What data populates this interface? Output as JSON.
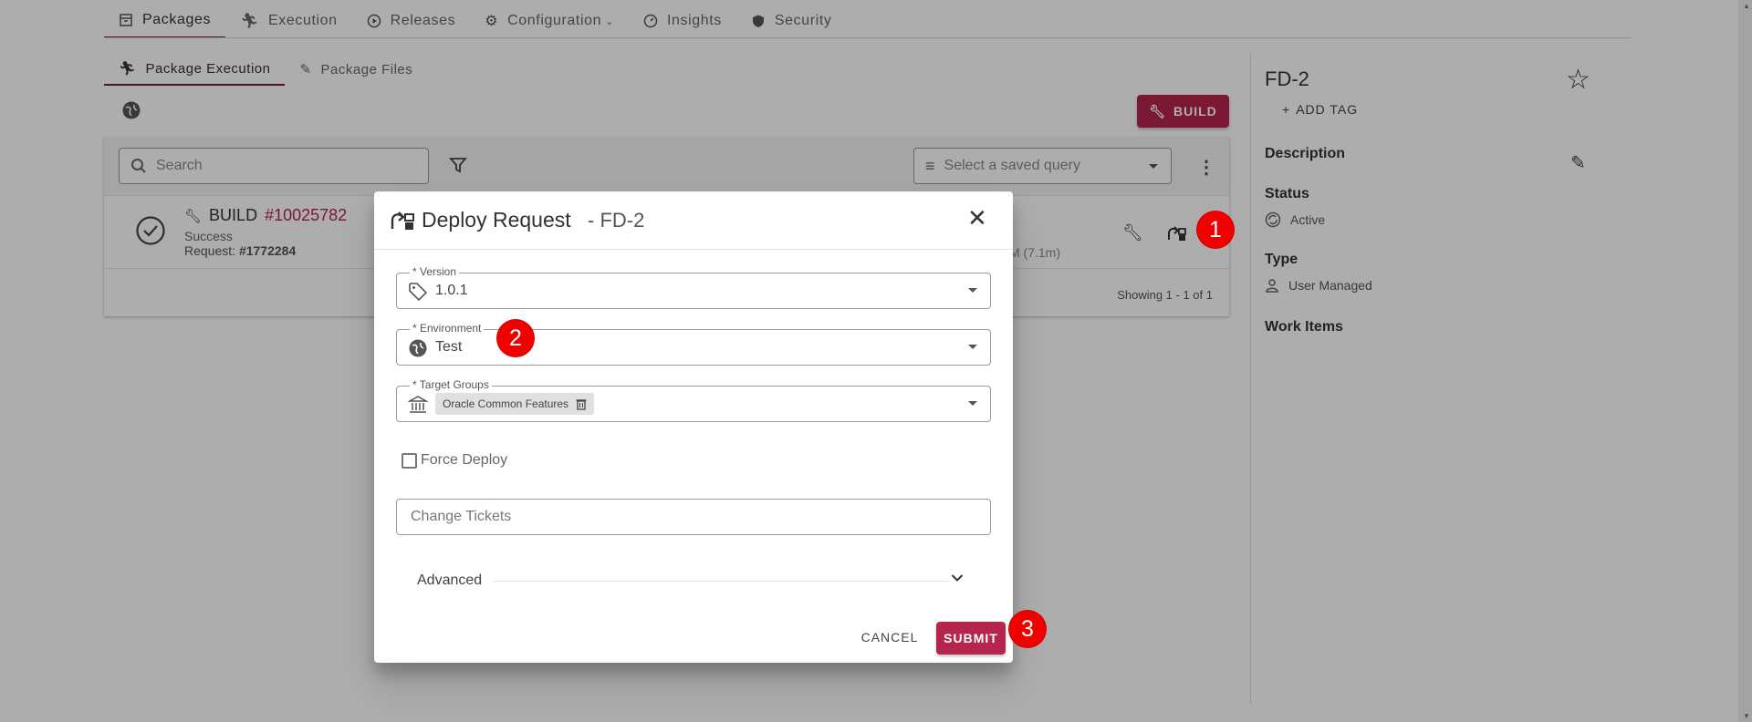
{
  "top_nav": {
    "items": [
      {
        "label": "Packages",
        "icon": "archive-icon",
        "active": true
      },
      {
        "label": "Execution",
        "icon": "walk-icon"
      },
      {
        "label": "Releases",
        "icon": "play-circle-icon"
      },
      {
        "label": "Configuration",
        "icon": "gear-icon"
      },
      {
        "label": "Insights",
        "icon": "gauge-icon"
      },
      {
        "label": "Security",
        "icon": "shield-icon"
      }
    ]
  },
  "sub_tabs": {
    "items": [
      {
        "label": "Package Execution",
        "icon": "walk-icon",
        "active": true
      },
      {
        "label": "Package Files",
        "icon": "pencil-icon"
      }
    ]
  },
  "toolbar": {
    "build_label": "BUILD",
    "search_placeholder": "Search",
    "saved_query_placeholder": "Select a saved query"
  },
  "execution_row": {
    "type": "BUILD",
    "number": "#10025782",
    "status": "Success",
    "request_label": "Request:",
    "request_id": "#1772284",
    "duration": "M (7.1m)"
  },
  "table_footer": "Showing 1 - 1 of 1",
  "sidebar": {
    "title": "FD-2",
    "add_tag": "ADD TAG",
    "description_label": "Description",
    "status_label": "Status",
    "status_value": "Active",
    "type_label": "Type",
    "type_value": "User Managed",
    "work_items_label": "Work Items"
  },
  "dialog": {
    "title": "Deploy Request",
    "subtitle": "- FD-2",
    "version": {
      "label": "* Version",
      "value": "1.0.1"
    },
    "environment": {
      "label": "* Environment",
      "value": "Test"
    },
    "target_groups": {
      "label": "* Target Groups",
      "chip": "Oracle Common Features"
    },
    "force_deploy_label": "Force Deploy",
    "change_tickets_placeholder": "Change Tickets",
    "advanced_label": "Advanced",
    "cancel_label": "CANCEL",
    "submit_label": "SUBMIT"
  },
  "markers": [
    "1",
    "2",
    "3"
  ],
  "colors": {
    "accent": "#b5264f",
    "tab_underline": "#6b2540",
    "marker": "#f20000"
  }
}
